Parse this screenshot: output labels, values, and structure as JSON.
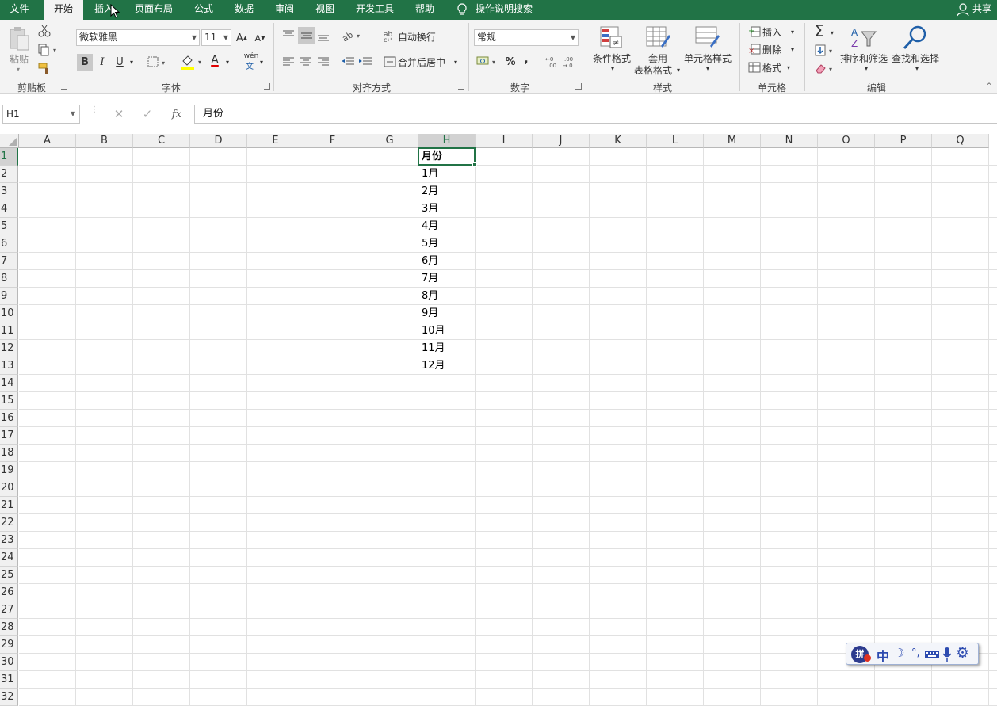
{
  "tabs": [
    "文件",
    "开始",
    "插入",
    "页面布局",
    "公式",
    "数据",
    "审阅",
    "视图",
    "开发工具",
    "帮助"
  ],
  "active_tab": "开始",
  "tell_me": "操作说明搜索",
  "share": "共享",
  "ribbon": {
    "clipboard": {
      "paste": "粘贴",
      "group": "剪贴板"
    },
    "font": {
      "name": "微软雅黑",
      "size": "11",
      "bold": "B",
      "italic": "I",
      "underline": "U",
      "font_color_glyph": "A",
      "phonetic_glyph": "wén",
      "phonetic_sub": "文",
      "grow_glyph": "A",
      "shrink_glyph": "A",
      "group": "字体"
    },
    "alignment": {
      "wrap": "自动换行",
      "merge": "合并后居中",
      "group": "对齐方式"
    },
    "number": {
      "format": "常规",
      "percent": "%",
      "comma": ",",
      "group": "数字"
    },
    "styles": {
      "conditional": "条件格式",
      "table_line1": "套用",
      "table_line2": "表格格式",
      "cell_styles": "单元格样式",
      "group": "样式"
    },
    "cells": {
      "insert": "插入",
      "delete": "删除",
      "format": "格式",
      "group": "单元格"
    },
    "editing": {
      "sort_filter": "排序和筛选",
      "find_select": "查找和选择",
      "group": "编辑",
      "sum_glyph": "Σ"
    }
  },
  "formula_bar": {
    "name_box": "H1",
    "fx": "fx",
    "content": "月份"
  },
  "columns": [
    "A",
    "B",
    "C",
    "D",
    "E",
    "F",
    "G",
    "H",
    "I",
    "J",
    "K",
    "L",
    "M",
    "N",
    "O",
    "P",
    "Q"
  ],
  "selected_column": "H",
  "rows": [
    "1",
    "2",
    "3",
    "4",
    "5",
    "6",
    "7",
    "8",
    "9",
    "10",
    "11",
    "12",
    "13",
    "14",
    "15",
    "16",
    "17",
    "18",
    "19",
    "20",
    "21",
    "22",
    "23",
    "24",
    "25",
    "26",
    "27",
    "28",
    "29",
    "30",
    "31",
    "32"
  ],
  "selected_row": "1",
  "cells_h": [
    "月份",
    "1月",
    "2月",
    "3月",
    "4月",
    "5月",
    "6月",
    "7月",
    "8月",
    "9月",
    "10月",
    "11月",
    "12月"
  ],
  "ime": {
    "mode": "中",
    "logo": "拼"
  },
  "colors": {
    "accent": "#217346",
    "selection": "#217346"
  }
}
